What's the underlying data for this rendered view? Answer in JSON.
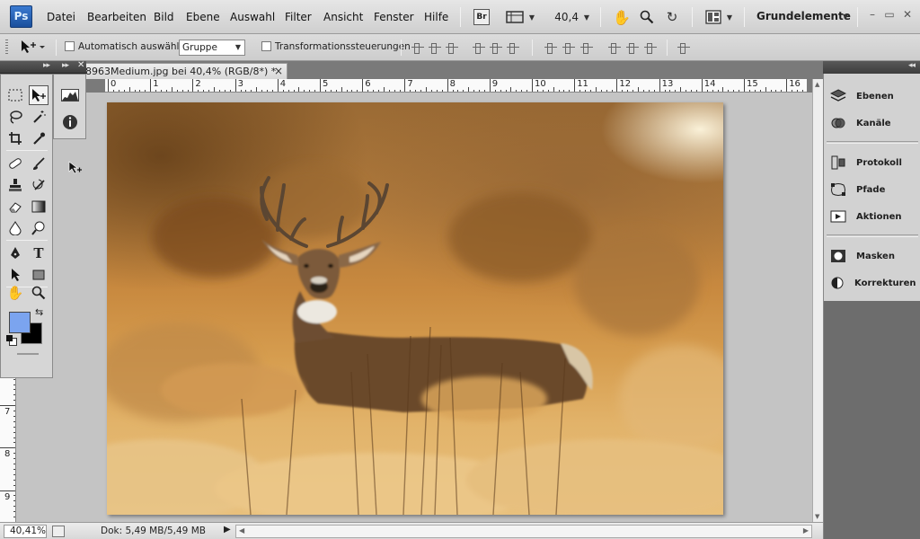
{
  "app": {
    "logo": "Ps",
    "menu": [
      "Datei",
      "Bearbeiten",
      "Bild",
      "Ebene",
      "Auswahl",
      "Filter",
      "Ansicht",
      "Fenster",
      "Hilfe"
    ],
    "bridge_label": "Br",
    "zoom_value": "40,4",
    "workspace": "Grundelemente",
    "window_controls": {
      "minimize": "–",
      "maximize": "▭",
      "close": "✕"
    }
  },
  "options_bar": {
    "auto_select_label": "Automatisch auswählen:",
    "auto_select_checked": false,
    "auto_select_target": "Gruppe",
    "transform_controls_label": "Transformationssteuerungen",
    "transform_controls_checked": false
  },
  "document": {
    "tab_title": "8963Medium.jpg bei 40,4% (RGB/8*) *",
    "close_label": "×"
  },
  "rulers": {
    "top": [
      "0",
      "1",
      "2",
      "3",
      "4",
      "5",
      "6",
      "7",
      "8",
      "9",
      "10",
      "11",
      "12",
      "13",
      "14",
      "15",
      "16"
    ],
    "left": [
      "7",
      "8",
      "9"
    ]
  },
  "status": {
    "zoom": "40,41%",
    "doc_info": "Dok: 5,49 MB/5,49 MB",
    "arrow": "▶"
  },
  "toolbox": {
    "fg_color": "#7ba4ef",
    "bg_color": "#000000"
  },
  "panels": [
    {
      "icon": "layers-icon",
      "label": "Ebenen"
    },
    {
      "icon": "channels-icon",
      "label": "Kanäle"
    },
    {
      "icon": "history-icon",
      "label": "Protokoll"
    },
    {
      "icon": "paths-icon",
      "label": "Pfade"
    },
    {
      "icon": "actions-icon",
      "label": "Aktionen"
    },
    {
      "icon": "masks-icon",
      "label": "Masken"
    },
    {
      "icon": "adjustments-icon",
      "label": "Korrekturen"
    }
  ],
  "colors": {
    "accent_ps": "#2a63b8",
    "canvas_bg": "#c4c4c4",
    "dock_dark": "#6d6d6d"
  }
}
